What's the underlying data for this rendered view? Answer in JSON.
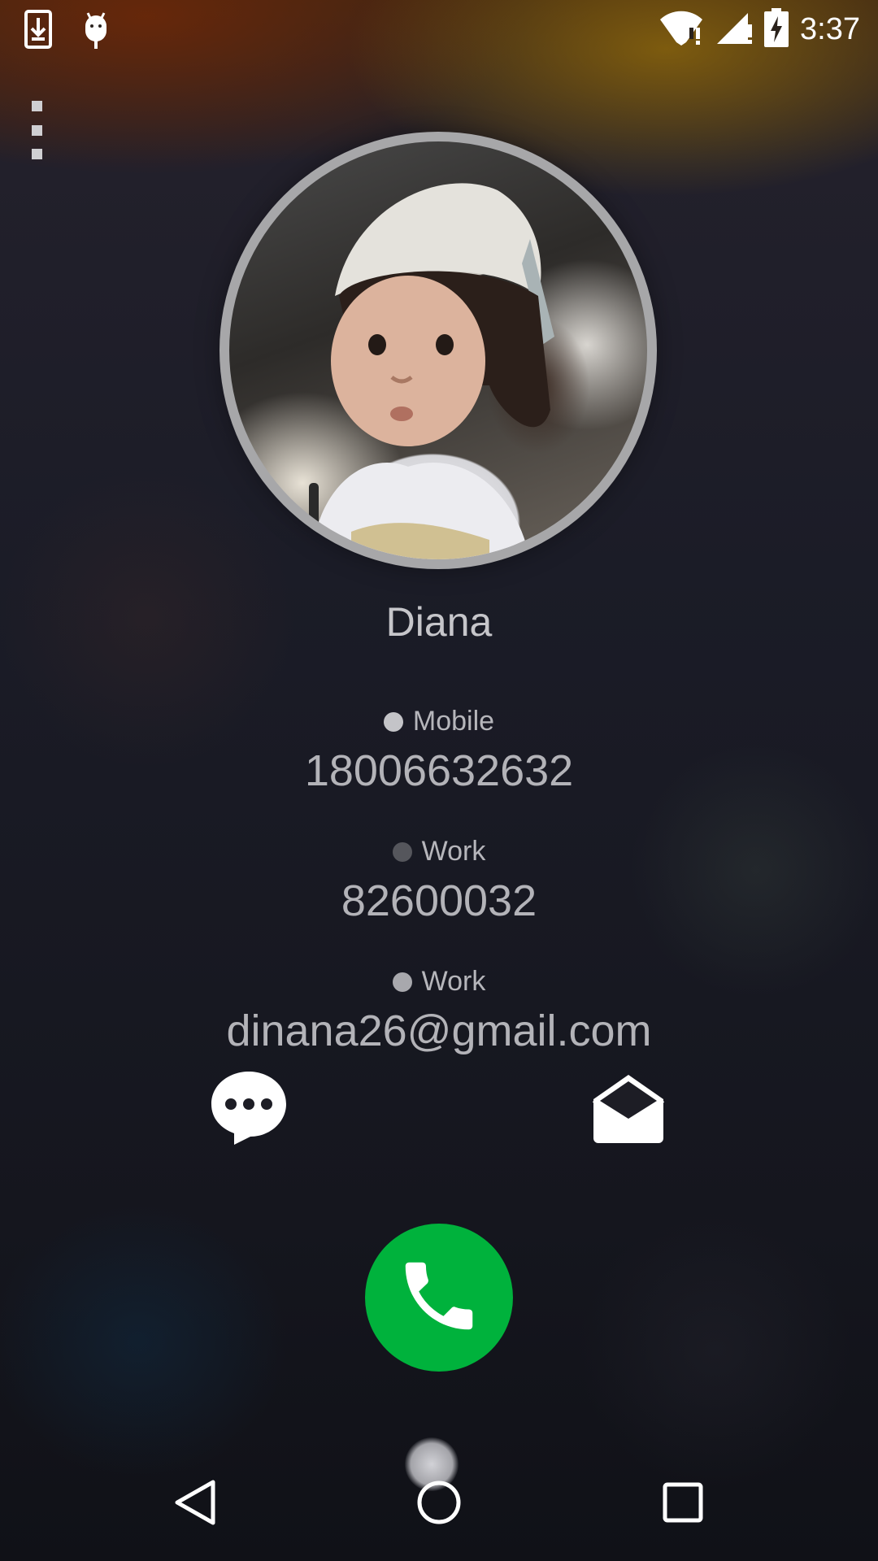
{
  "status_bar": {
    "time": "3:37",
    "left_icons": [
      "download-notification-icon",
      "android-debug-icon"
    ],
    "right_icons": [
      "wifi-icon",
      "signal-icon",
      "battery-charging-icon"
    ]
  },
  "contact": {
    "name": "Diana",
    "entries": [
      {
        "type": "Mobile",
        "value": "18006632632",
        "dot_color": "#c4c4c8"
      },
      {
        "type": "Work",
        "value": "82600032",
        "dot_color": "#55565c"
      },
      {
        "type": "Work",
        "value": "dinana26@gmail.com",
        "dot_color": "#a8a8ad"
      }
    ]
  },
  "actions": {
    "message_icon": "chat-bubble-icon",
    "email_icon": "envelope-open-icon",
    "call_icon": "phone-icon",
    "call_color": "#00b23c"
  },
  "nav_bar": {
    "icons": [
      "back-icon",
      "home-icon",
      "recents-icon"
    ]
  }
}
